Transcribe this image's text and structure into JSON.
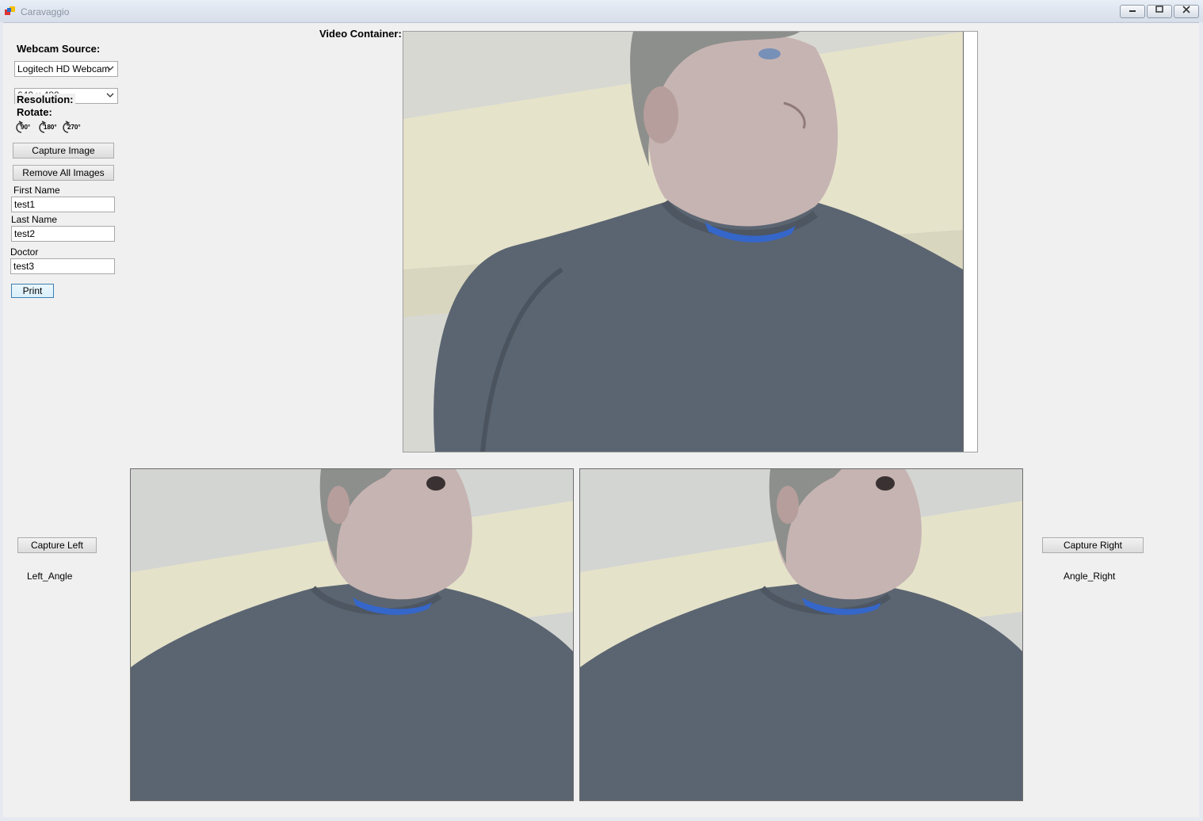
{
  "window": {
    "title": "Caravaggio"
  },
  "left_panel": {
    "webcam_source_label": "Webcam Source:",
    "webcam_selected": "Logitech HD Webcam",
    "resolution_selected": "640 x 480",
    "resolution_label": "Resolution:",
    "rotate_label": "Rotate:",
    "rotate_options": [
      "90°",
      "180°",
      "270°"
    ],
    "capture_image_label": "Capture Image",
    "remove_all_label": "Remove All Images",
    "first_name_label": "First Name",
    "first_name_value": "test1",
    "last_name_label": "Last Name",
    "last_name_value": "test2",
    "doctor_label": "Doctor",
    "doctor_value": "test3",
    "print_label": "Print"
  },
  "video": {
    "label": "Video Container:"
  },
  "captures": {
    "left_button": "Capture Left",
    "left_label": "Left_Angle",
    "right_button": "Capture Right",
    "right_label": "Angle_Right"
  },
  "colors": {
    "sweater": "#5a6470",
    "wall": "#e4e2cc",
    "ceiling": "#d4d6d2",
    "skin": "#c9b6b4",
    "undershirt": "#3566c9",
    "focus_border": "#3c7fb1"
  }
}
